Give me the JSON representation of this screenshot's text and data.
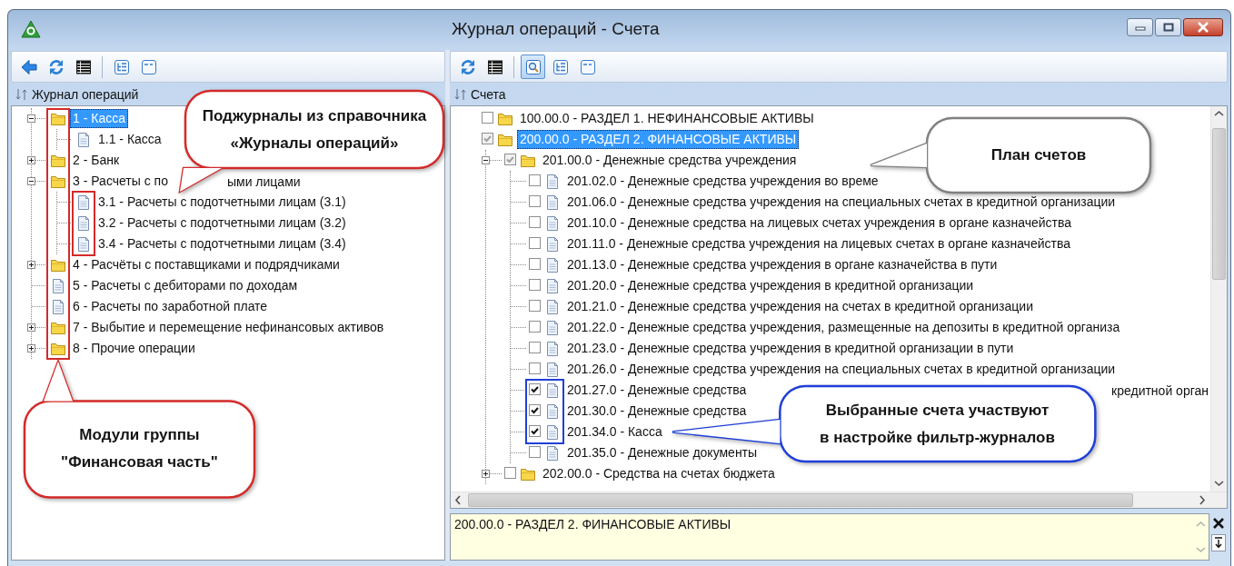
{
  "window": {
    "title": "Журнал операций - Счета"
  },
  "left_pane": {
    "toolbar": {
      "groups": [
        [
          {
            "kind": "back",
            "selected": false
          },
          {
            "kind": "refresh",
            "selected": false
          },
          {
            "kind": "grid",
            "selected": false
          }
        ],
        [
          {
            "kind": "tree",
            "selected": false
          },
          {
            "kind": "panel",
            "selected": false
          }
        ]
      ]
    },
    "header": "Журнал операций",
    "tree": [
      {
        "label": "1 - Касса",
        "kind": "folder",
        "selected": true,
        "expanded": true,
        "children": [
          {
            "label": "1.1 - Касса",
            "kind": "doc",
            "selected": false
          }
        ]
      },
      {
        "label": "2 - Банк",
        "kind": "folder",
        "selected": false,
        "expanded": false
      },
      {
        "label": "3 - Расчеты с по",
        "tail": "ыми лицами",
        "kind": "folder",
        "selected": false,
        "expanded": true,
        "children": [
          {
            "label": "3.1 - Расчеты с подотчетными лицам (3.1)",
            "kind": "doc",
            "selected": false
          },
          {
            "label": "3.2 - Расчеты с подотчетными лицам (3.2)",
            "kind": "doc",
            "selected": false
          },
          {
            "label": "3.4 - Расчеты с подотчетными лицам (3.4)",
            "kind": "doc",
            "selected": false
          }
        ]
      },
      {
        "label": "4 - Расчёты с поставщиками и подрядчиками",
        "kind": "folder",
        "selected": false,
        "expanded": false
      },
      {
        "label": "5 - Расчеты с дебиторами по доходам",
        "kind": "doc",
        "selected": false
      },
      {
        "label": "6 - Расчеты по заработной плате",
        "kind": "doc",
        "selected": false
      },
      {
        "label": "7 - Выбытие и перемещение нефинансовых активов",
        "kind": "folder",
        "selected": false,
        "expanded": false
      },
      {
        "label": "8 - Прочие операции",
        "kind": "folder",
        "selected": false,
        "expanded": false
      }
    ]
  },
  "right_pane": {
    "toolbar": {
      "groups": [
        [
          {
            "kind": "refresh",
            "selected": false
          },
          {
            "kind": "grid",
            "selected": false
          }
        ],
        [
          {
            "kind": "preview",
            "selected": true
          },
          {
            "kind": "tree",
            "selected": false
          },
          {
            "kind": "panel",
            "selected": false
          }
        ]
      ]
    },
    "header": "Счета",
    "tree": [
      {
        "label": "100.00.0 - РАЗДЕЛ 1. НЕФИНАНСОВЫЕ АКТИВЫ",
        "kind": "folder",
        "checked": false,
        "greyed": false,
        "selected": false
      },
      {
        "label": "200.00.0 - РАЗДЕЛ 2. ФИНАНСОВЫЕ АКТИВЫ",
        "kind": "folder",
        "checked": true,
        "greyed": true,
        "selected": true,
        "children": [
          {
            "label": "201.00.0 - Денежные средства учреждения",
            "kind": "folder",
            "checked": true,
            "greyed": true,
            "selected": false,
            "expanded": true,
            "children": [
              {
                "label": "201.02.0 - Денежные средства учреждения во време",
                "kind": "doc",
                "checked": false,
                "greyed": false,
                "selected": false
              },
              {
                "label": "201.06.0 - Денежные средства учреждения на специальных счетах в кредитной организации",
                "kind": "doc",
                "checked": false,
                "greyed": false,
                "selected": false
              },
              {
                "label": "201.10.0 - Денежные средства на лицевых счетах учреждения в органе казначейства",
                "kind": "doc",
                "checked": false,
                "greyed": false,
                "selected": false
              },
              {
                "label": "201.11.0 - Денежные средства учреждения на лицевых счетах в органе казначейства",
                "kind": "doc",
                "checked": false,
                "greyed": false,
                "selected": false
              },
              {
                "label": "201.13.0 - Денежные средства учреждения в органе казначейства в пути",
                "kind": "doc",
                "checked": false,
                "greyed": false,
                "selected": false
              },
              {
                "label": "201.20.0 - Денежные средства учреждения в кредитной организации",
                "kind": "doc",
                "checked": false,
                "greyed": false,
                "selected": false
              },
              {
                "label": "201.21.0 - Денежные средства учреждения на счетах в кредитной организации",
                "kind": "doc",
                "checked": false,
                "greyed": false,
                "selected": false
              },
              {
                "label": "201.22.0 - Денежные средства учреждения, размещенные на депозиты в кредитной организа",
                "kind": "doc",
                "checked": false,
                "greyed": false,
                "selected": false
              },
              {
                "label": "201.23.0 - Денежные средства учреждения в кредитной организации в пути",
                "kind": "doc",
                "checked": false,
                "greyed": false,
                "selected": false
              },
              {
                "label": "201.26.0 - Денежные средства учреждения на специальных счетах в кредитной организации",
                "kind": "doc",
                "checked": false,
                "greyed": false,
                "selected": false
              },
              {
                "label": "201.27.0 - Денежные средства",
                "tail": "кредитной орган",
                "kind": "doc",
                "checked": true,
                "greyed": false,
                "selected": false
              },
              {
                "label": "201.30.0 - Денежные средства",
                "kind": "doc",
                "checked": true,
                "greyed": false,
                "selected": false
              },
              {
                "label": "201.34.0 - Касса",
                "kind": "doc",
                "checked": true,
                "greyed": false,
                "selected": false
              },
              {
                "label": "201.35.0 - Денежные документы",
                "kind": "doc",
                "checked": false,
                "greyed": false,
                "selected": false
              }
            ]
          },
          {
            "label": "202.00.0 - Средства на счетах бюджета",
            "kind": "folder",
            "checked": false,
            "greyed": false,
            "selected": false,
            "expanded": false
          }
        ]
      }
    ],
    "memo": {
      "value": "200.00.0 - РАЗДЕЛ 2. ФИНАНСОВЫЕ АКТИВЫ"
    }
  },
  "annotations": {
    "callouts": [
      {
        "lines": [
          "Поджурналы из справочника",
          "«Журналы операций»"
        ],
        "color": "#d42a2a"
      },
      {
        "lines": [
          "Модули группы",
          "\"Финансовая часть\""
        ],
        "color": "#d42a2a"
      },
      {
        "lines": [
          "План счетов"
        ],
        "color": "#808080"
      },
      {
        "lines": [
          "Выбранные счета участвуют",
          "в настройке фильтр-журналов"
        ],
        "color": "#1f3fd8"
      }
    ],
    "frames": [
      {
        "color": "#d42a2a"
      },
      {
        "color": "#d42a2a"
      },
      {
        "color": "#1f3fd8"
      }
    ]
  }
}
